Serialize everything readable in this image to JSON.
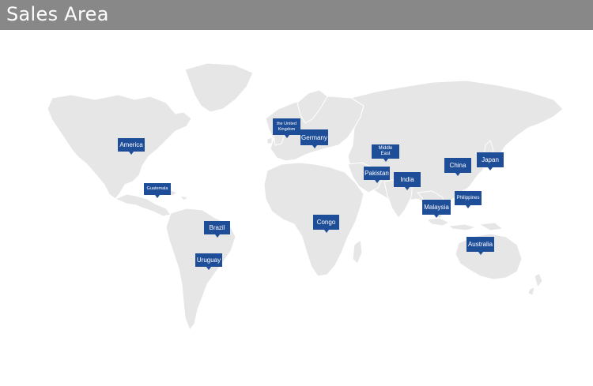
{
  "header": {
    "title": "Sales Area"
  },
  "colors": {
    "header_bg": "#888888",
    "marker_bg": "#1f4e99",
    "land": "#e6e6e6"
  },
  "map": {
    "markers": [
      {
        "id": "america",
        "label": "America"
      },
      {
        "id": "guatemala",
        "label": "Guatemala"
      },
      {
        "id": "brazil",
        "label": "Brazil"
      },
      {
        "id": "uruguay",
        "label": "Uruguay"
      },
      {
        "id": "uk",
        "label": "the United Kingdom"
      },
      {
        "id": "germany",
        "label": "Germany"
      },
      {
        "id": "congo",
        "label": "Congo"
      },
      {
        "id": "middle-east",
        "label": "Middle East"
      },
      {
        "id": "pakistan",
        "label": "Pakistan"
      },
      {
        "id": "india",
        "label": "India"
      },
      {
        "id": "china",
        "label": "China"
      },
      {
        "id": "japan",
        "label": "Japan"
      },
      {
        "id": "malaysia",
        "label": "Malaysia"
      },
      {
        "id": "philippines",
        "label": "Philippines"
      },
      {
        "id": "australia",
        "label": "Australia"
      }
    ]
  }
}
